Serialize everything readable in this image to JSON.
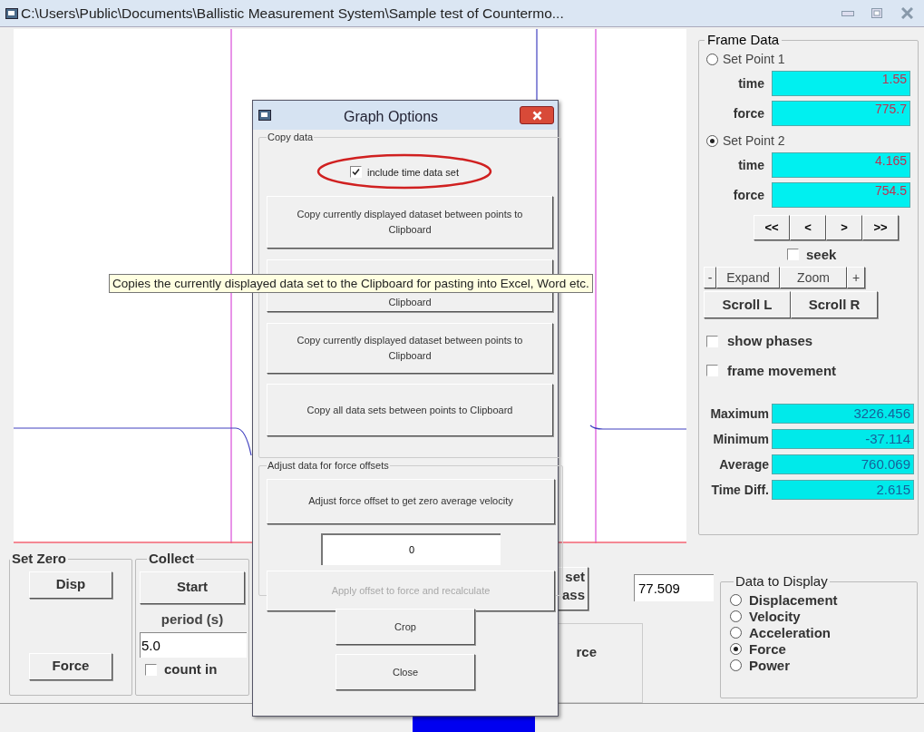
{
  "window": {
    "title": "C:\\Users\\Public\\Documents\\Ballistic Measurement System\\Sample test of Countermo..."
  },
  "frame_data": {
    "title": "Frame Data",
    "points": [
      {
        "label": "Set Point 1",
        "selected": false,
        "fields": [
          {
            "label": "time",
            "value": "1.55"
          },
          {
            "label": "force",
            "value": "775.7"
          }
        ]
      },
      {
        "label": "Set Point 2",
        "selected": true,
        "fields": [
          {
            "label": "time",
            "value": "4.165"
          },
          {
            "label": "force",
            "value": "754.5"
          }
        ]
      }
    ],
    "nav_buttons": [
      "<<",
      "<",
      ">",
      ">>"
    ],
    "seek": {
      "label": "seek",
      "checked": false
    },
    "zoom_buttons": [
      "-",
      "Expand",
      "Zoom",
      "+"
    ],
    "scroll_buttons": [
      "Scroll L",
      "Scroll R"
    ],
    "options": [
      {
        "label": "show phases",
        "checked": false
      },
      {
        "label": "frame movement",
        "checked": false
      }
    ],
    "stats": [
      {
        "label": "Maximum",
        "value": "3226.456"
      },
      {
        "label": "Minimum",
        "value": "-37.114"
      },
      {
        "label": "Average",
        "value": "760.069"
      },
      {
        "label": "Time Diff.",
        "value": "2.615"
      }
    ]
  },
  "set_zero": {
    "title": "Set Zero",
    "buttons": [
      "Disp",
      "Force"
    ]
  },
  "collect": {
    "title": "Collect",
    "button": "Start",
    "period_label": "period (s)",
    "period_value": "5.0",
    "count_in": {
      "label": "count in",
      "checked": false
    }
  },
  "mass": {
    "button_lines": [
      "set",
      "ass"
    ],
    "value": "77.509"
  },
  "partial_group": {
    "label": "rce"
  },
  "data_to_display": {
    "title": "Data to Display",
    "options": [
      {
        "label": "Displacement",
        "selected": false
      },
      {
        "label": "Velocity",
        "selected": false
      },
      {
        "label": "Acceleration",
        "selected": false
      },
      {
        "label": "Force",
        "selected": true
      },
      {
        "label": "Power",
        "selected": false
      }
    ]
  },
  "dialog": {
    "title": "Graph Options",
    "copy_group": {
      "title": "Copy data",
      "include_time": {
        "label": "include time data set",
        "checked": true
      },
      "buttons": [
        "Copy currently displayed dataset between points to Clipboard",
        "Clipboard",
        "Copy currently displayed dataset between points to Clipboard",
        "Copy all data sets between points to Clipboard"
      ]
    },
    "offset_group": {
      "title": "Adjust data for force offsets",
      "adjust_button": "Adjust force offset to get zero average velocity",
      "offset_value": "0",
      "apply_button": {
        "label": "Apply offset to force and recalculate",
        "disabled": true
      }
    },
    "buttons": [
      "Crop",
      "Close"
    ]
  },
  "tooltip": {
    "text": "Copies the currently displayed data set to the Clipboard for pasting into Excel, Word etc."
  }
}
